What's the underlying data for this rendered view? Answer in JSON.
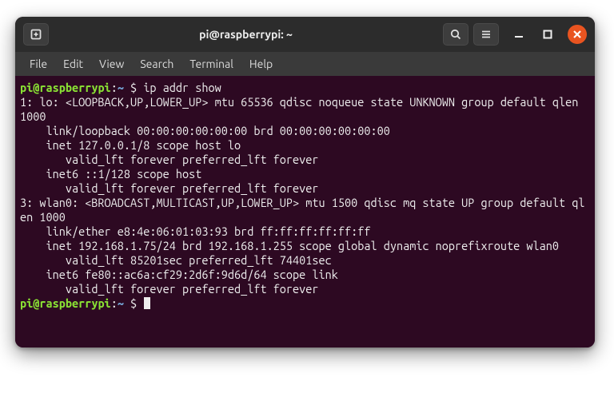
{
  "colors": {
    "terminal_bg": "#2d0922",
    "prompt_user": "#8ae234",
    "prompt_path": "#729fcf",
    "close_btn": "#e95420"
  },
  "titlebar": {
    "title": "pi@raspberrypi: ~",
    "new_tab_icon": "new-tab-icon",
    "search_icon": "search-icon",
    "menu_icon": "hamburger-icon",
    "minimize_icon": "minimize-icon",
    "maximize_icon": "maximize-icon",
    "close_icon": "close-icon"
  },
  "menubar": {
    "items": [
      "File",
      "Edit",
      "View",
      "Search",
      "Terminal",
      "Help"
    ]
  },
  "prompt": {
    "user_host": "pi@raspberrypi",
    "colon": ":",
    "path": "~",
    "dollar": " $ "
  },
  "command": "ip addr show",
  "output": "1: lo: <LOOPBACK,UP,LOWER_UP> mtu 65536 qdisc noqueue state UNKNOWN group default qlen 1000\n    link/loopback 00:00:00:00:00:00 brd 00:00:00:00:00:00\n    inet 127.0.0.1/8 scope host lo\n       valid_lft forever preferred_lft forever\n    inet6 ::1/128 scope host\n       valid_lft forever preferred_lft forever\n3: wlan0: <BROADCAST,MULTICAST,UP,LOWER_UP> mtu 1500 qdisc mq state UP group default qlen 1000\n    link/ether e8:4e:06:01:03:93 brd ff:ff:ff:ff:ff:ff\n    inet 192.168.1.75/24 brd 192.168.1.255 scope global dynamic noprefixroute wlan0\n       valid_lft 85201sec preferred_lft 74401sec\n    inet6 fe80::ac6a:cf29:2d6f:9d6d/64 scope link\n       valid_lft forever preferred_lft forever"
}
